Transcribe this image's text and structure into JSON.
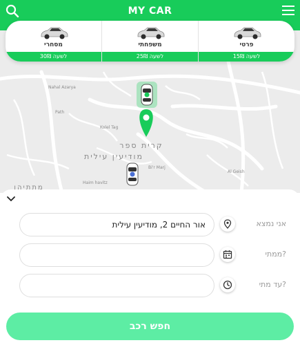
{
  "header": {
    "title": "MY CAR",
    "search_icon": "search-icon",
    "menu_icon": "hamburger-menu-icon",
    "bg_color": "#18cc5a"
  },
  "car_types": [
    {
      "name": "פרטי",
      "price": "15₪ לשעה"
    },
    {
      "name": "משפחתי",
      "price": "25₪ לשעה"
    },
    {
      "name": "מסחרי",
      "price": "30₪ לשעה"
    }
  ],
  "map": {
    "labels": [
      "קרית ספר",
      "מודיעין עילית",
      "מתתיהו",
      "Bi'r Marj",
      "Al Geish",
      "Haim havitz",
      "Kolel Tag",
      "Nahal Azarya",
      "Path"
    ]
  },
  "form": {
    "pickup_label": "אני נמצא",
    "pickup_value": "אור החיים 2, מודיעין עילית",
    "from_label": "ממתי?",
    "from_value": "",
    "until_label": "עד מתי?",
    "until_value": "",
    "submit_label": "חפש רכב",
    "submit_color": "#5deda4"
  }
}
